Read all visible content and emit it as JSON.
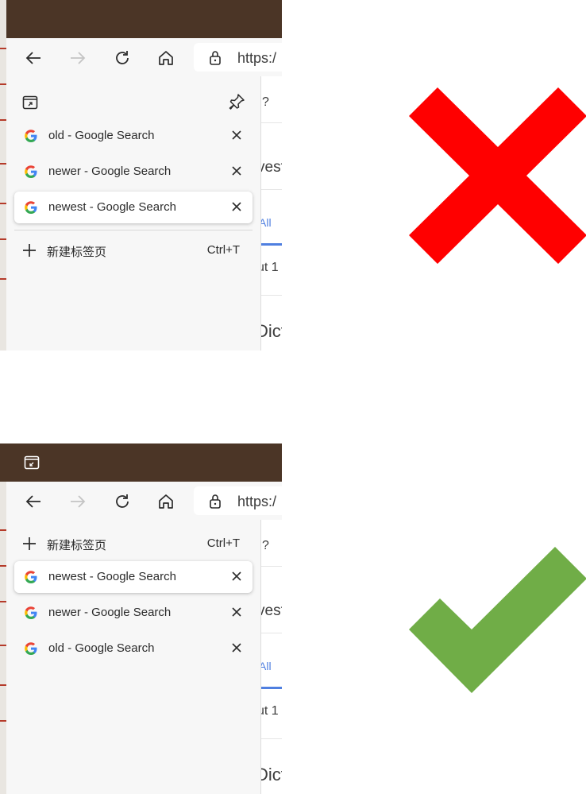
{
  "top_example": {
    "url_text": "https:/",
    "tabs": [
      {
        "title": "old - Google Search"
      },
      {
        "title": "newer - Google Search"
      },
      {
        "title": "newest - Google Search"
      }
    ],
    "new_tab": {
      "label": "新建标签页",
      "shortcut": "Ctrl+T"
    },
    "page_fragments": [
      "?",
      "vest",
      "All",
      "ut 1",
      "Dict"
    ],
    "verdict": "incorrect"
  },
  "bottom_example": {
    "url_text": "https:/",
    "new_tab": {
      "label": "新建标签页",
      "shortcut": "Ctrl+T"
    },
    "tabs": [
      {
        "title": "newest - Google Search"
      },
      {
        "title": "newer - Google Search"
      },
      {
        "title": "old - Google Search"
      }
    ],
    "page_fragments": [
      "?",
      "vest",
      "All",
      "ut 1",
      "Dict"
    ],
    "verdict": "correct"
  },
  "colors": {
    "titlebar": "#4b3526",
    "panel": "#f7f7f7",
    "cross": "#ff0000",
    "check": "#70ad47"
  },
  "icons": [
    "back-icon",
    "forward-icon",
    "refresh-icon",
    "home-icon",
    "lock-icon",
    "vertical-tabs-icon",
    "pin-icon",
    "google-favicon",
    "close-icon",
    "plus-icon",
    "red-cross-icon",
    "green-check-icon"
  ]
}
